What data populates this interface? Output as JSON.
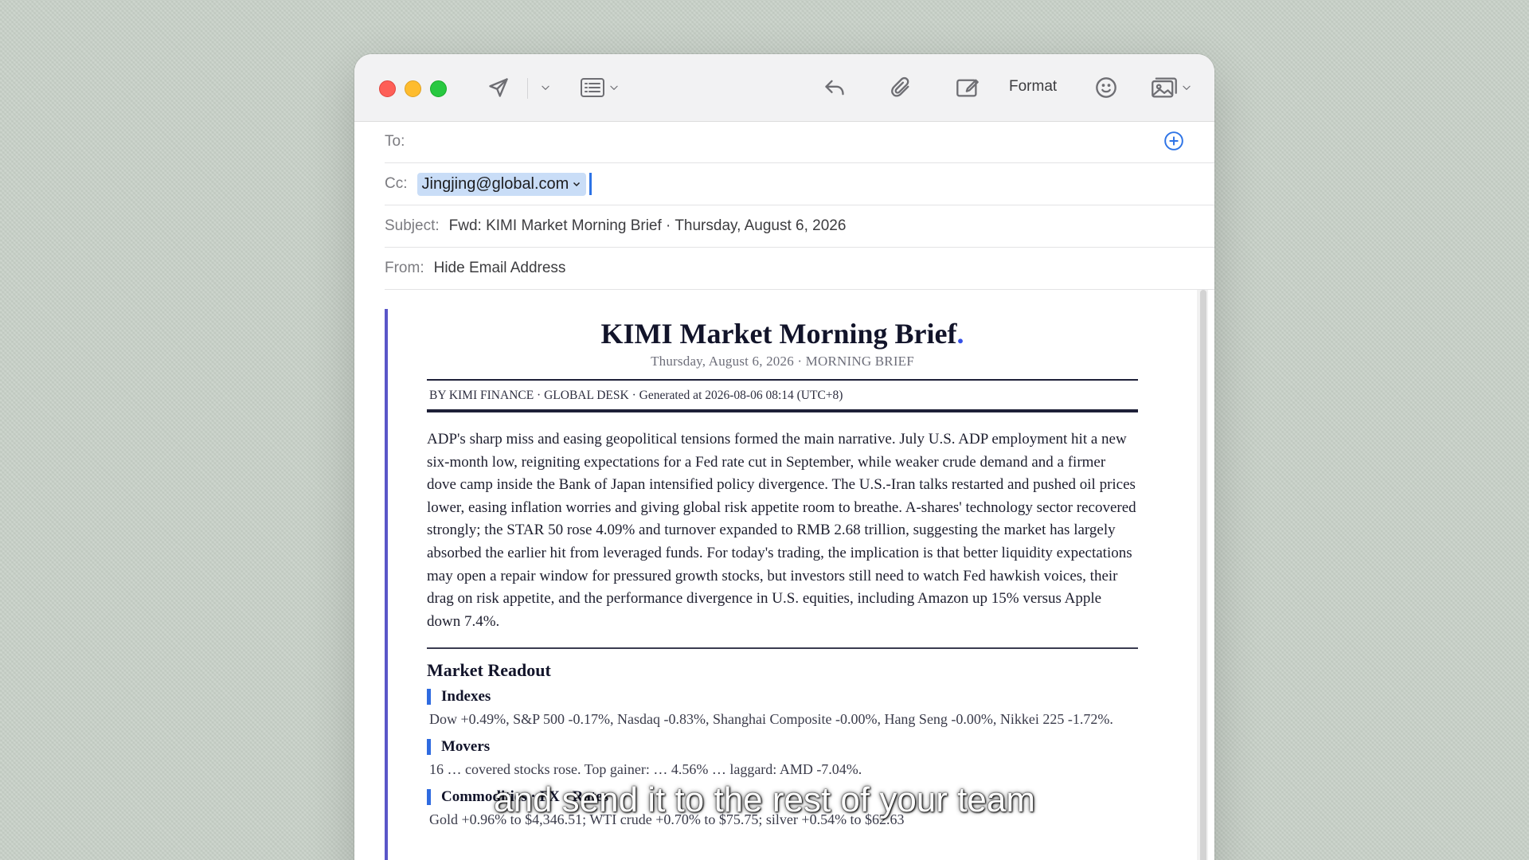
{
  "toolbar": {
    "format_label": "Format"
  },
  "headers": {
    "to_label": "To:",
    "cc_label": "Cc:",
    "cc_recipient": "Jingjing@global.com",
    "subject_label": "Subject:",
    "subject_value": "Fwd: KIMI Market Morning Brief · Thursday, August 6, 2026",
    "from_label": "From:",
    "from_value": "Hide Email Address"
  },
  "newsletter": {
    "title": "KIMI Market Morning Brief",
    "title_dot": ".",
    "subtitle": "Thursday, August 6, 2026 · MORNING BRIEF",
    "byline": "BY KIMI FINANCE · GLOBAL DESK · Generated at 2026-08-06 08:14 (UTC+8)",
    "summary": "ADP's sharp miss and easing geopolitical tensions formed the main narrative. July U.S. ADP employment hit a new six-month low, reigniting expectations for a Fed rate cut in September, while weaker crude demand and a firmer dove camp inside the Bank of Japan intensified policy divergence. The U.S.-Iran talks restarted and pushed oil prices lower, easing inflation worries and giving global risk appetite room to breathe. A-shares' technology sector recovered strongly; the STAR 50 rose 4.09% and turnover expanded to RMB 2.68 trillion, suggesting the market has largely absorbed the earlier hit from leveraged funds. For today's trading, the implication is that better liquidity expectations may open a repair window for pressured growth stocks, but investors still need to watch Fed hawkish voices, their drag on risk appetite, and the performance divergence in U.S. equities, including Amazon up 15% versus Apple down 7.4%.",
    "section_title": "Market Readout",
    "indexes_title": "Indexes",
    "indexes_text": "Dow +0.49%, S&P 500 -0.17%, Nasdaq -0.83%, Shanghai Composite -0.00%, Hang Seng -0.00%, Nikkei 225 -1.72%.",
    "movers_title": "Movers",
    "movers_text": "16 … covered stocks rose. Top gainer: … 4.56% … laggard: AMD -7.04%.",
    "commodities_title": "Commodities · FX · Rates",
    "commodities_text": "Gold +0.96% to $4,346.51; WTI crude +0.70% to $75.75; silver +0.54% to $62.63"
  },
  "caption": "and send it to the rest of your team"
}
